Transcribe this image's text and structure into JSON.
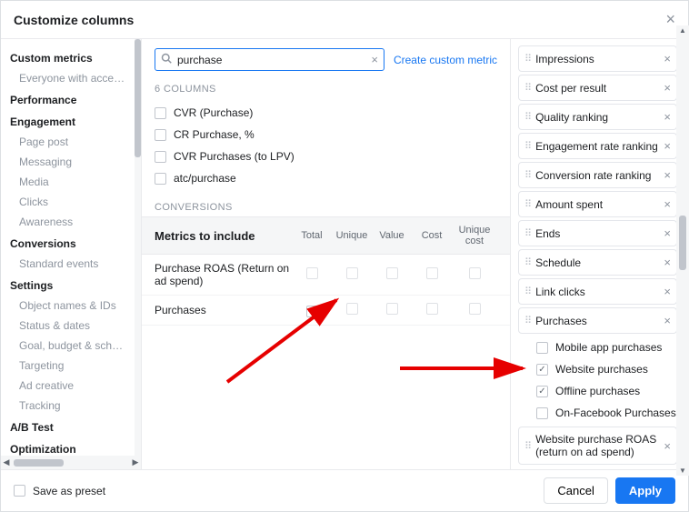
{
  "header": {
    "title": "Customize columns"
  },
  "sidebar": {
    "sections": [
      {
        "title": "Custom metrics",
        "items": [
          "Everyone with access to"
        ]
      },
      {
        "title": "Performance",
        "items": []
      },
      {
        "title": "Engagement",
        "items": [
          "Page post",
          "Messaging",
          "Media",
          "Clicks",
          "Awareness"
        ]
      },
      {
        "title": "Conversions",
        "items": [
          "Standard events"
        ]
      },
      {
        "title": "Settings",
        "items": [
          "Object names & IDs",
          "Status & dates",
          "Goal, budget & schedule",
          "Targeting",
          "Ad creative",
          "Tracking"
        ]
      },
      {
        "title": "A/B Test",
        "items": []
      },
      {
        "title": "Optimization",
        "items": []
      }
    ]
  },
  "center": {
    "search": {
      "value": "purchase"
    },
    "create_link": "Create custom metric",
    "columns_count_label": "6 COLUMNS",
    "column_results": [
      {
        "label": "CVR (Purchase)",
        "checked": false
      },
      {
        "label": "CR Purchase, %",
        "checked": false
      },
      {
        "label": "CVR Purchases (to LPV)",
        "checked": false
      },
      {
        "label": "atc/purchase",
        "checked": false
      }
    ],
    "conversions_label": "CONVERSIONS",
    "metrics_header": {
      "title": "Metrics to include",
      "cols": [
        "Total",
        "Unique",
        "Value",
        "Cost",
        "Unique cost"
      ]
    },
    "metrics_rows": [
      {
        "label": "Purchase ROAS (Return on ad spend)",
        "cells": [
          false,
          false,
          false,
          false,
          false
        ]
      },
      {
        "label": "Purchases",
        "cells": [
          true,
          false,
          false,
          false,
          false
        ]
      }
    ]
  },
  "selected": {
    "items": [
      {
        "label": "Impressions"
      },
      {
        "label": "Cost per result"
      },
      {
        "label": "Quality ranking"
      },
      {
        "label": "Engagement rate ranking"
      },
      {
        "label": "Conversion rate ranking"
      },
      {
        "label": "Amount spent"
      },
      {
        "label": "Ends"
      },
      {
        "label": "Schedule"
      },
      {
        "label": "Link clicks"
      },
      {
        "label": "Purchases",
        "children": [
          {
            "label": "Mobile app purchases",
            "checked": false
          },
          {
            "label": "Website purchases",
            "checked": true
          },
          {
            "label": "Offline purchases",
            "checked": true
          },
          {
            "label": "On-Facebook Purchases",
            "checked": false
          }
        ]
      },
      {
        "label": "Website purchase ROAS (return on ad spend)"
      }
    ]
  },
  "footer": {
    "save_preset": "Save as preset",
    "cancel": "Cancel",
    "apply": "Apply"
  }
}
